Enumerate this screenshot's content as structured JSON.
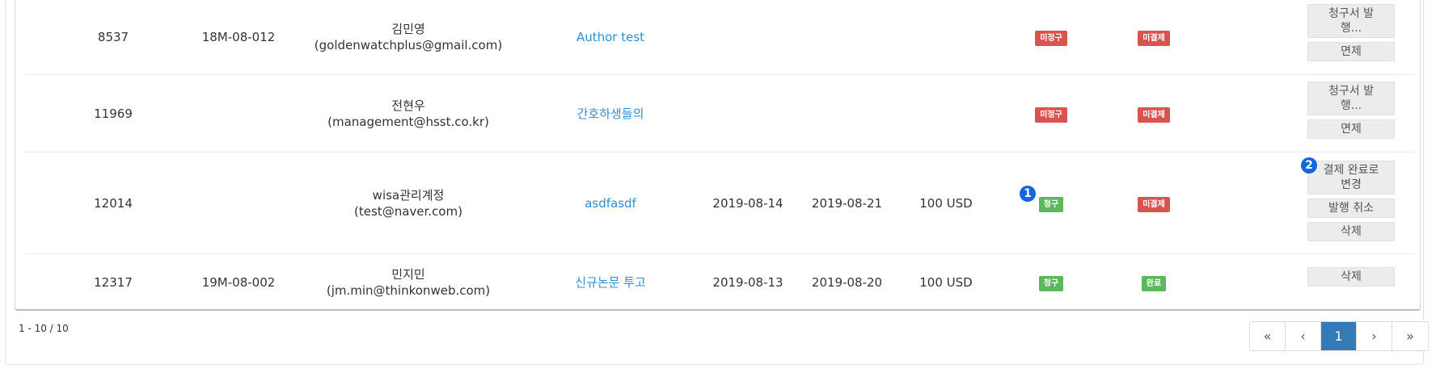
{
  "rows": [
    {
      "id": "8537",
      "code": "18M-08-012",
      "name": "김민영",
      "email": "(goldenwatchplus@gmail.com)",
      "title": "Author test",
      "date1": "",
      "date2": "",
      "amount": "",
      "badge1": "미정구",
      "badge2": "미결제",
      "actions": [
        "청구서 발행...",
        "면제"
      ]
    },
    {
      "id": "11969",
      "code": "",
      "name": "전현우",
      "email": "(management@hsst.co.kr)",
      "title": "간호하생들의",
      "date1": "",
      "date2": "",
      "amount": "",
      "badge1": "미정구",
      "badge2": "미결제",
      "actions": [
        "청구서 발행...",
        "면제"
      ]
    },
    {
      "id": "12014",
      "code": "",
      "name": "wisa관리계정",
      "email": "(test@naver.com)",
      "title": "asdfasdf",
      "date1": "2019-08-14",
      "date2": "2019-08-21",
      "amount": "100 USD",
      "badge1": "청구",
      "badge2": "미결제",
      "actions": [
        "결제 완료로 변경",
        "발행 취소",
        "삭제"
      ]
    },
    {
      "id": "12317",
      "code": "19M-08-002",
      "name": "민지민",
      "email": "(jm.min@thinkonweb.com)",
      "title": "신규논문 투고",
      "date1": "2019-08-13",
      "date2": "2019-08-20",
      "amount": "100 USD",
      "badge1": "청구",
      "badge2": "완료",
      "actions": [
        "삭제"
      ]
    }
  ],
  "markers": [
    "1",
    "2"
  ],
  "pagination": {
    "info": "1 - 10 / 10",
    "first": "«",
    "prev": "‹",
    "current": "1",
    "next": "›",
    "last": "»"
  },
  "colors": {
    "badge_red": "#d9534f",
    "badge_green": "#5cb85c",
    "link": "#2f8fd5",
    "pager_active": "#337ab7",
    "marker": "#1565e0"
  }
}
